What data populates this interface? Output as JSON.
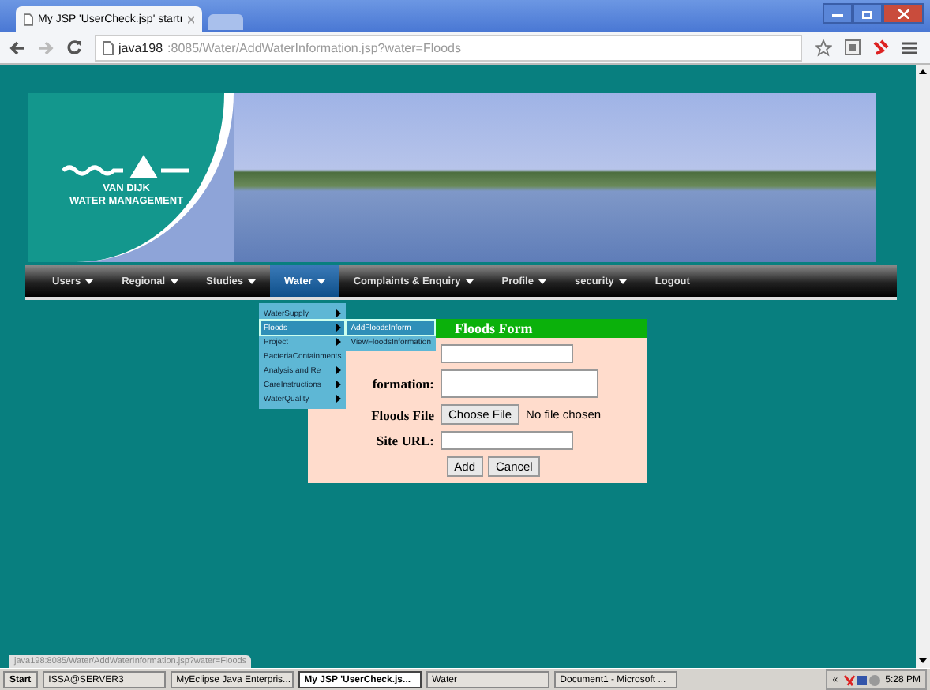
{
  "browser": {
    "tabs": [
      {
        "title": "My JSP 'UserCheck.jsp' startı",
        "selected": true
      }
    ],
    "url_host": "java198",
    "url_path": ":8085/Water/AddWaterInformation.jsp?water=Floods"
  },
  "logo": {
    "line1": "VAN DIJK",
    "line2": "WATER MANAGEMENT"
  },
  "nav": [
    {
      "label": "Users",
      "dropdown": true,
      "selected": false
    },
    {
      "label": "Regional",
      "dropdown": true,
      "selected": false
    },
    {
      "label": "Studies",
      "dropdown": true,
      "selected": false
    },
    {
      "label": "Water",
      "dropdown": true,
      "selected": true
    },
    {
      "label": "Complaints & Enquiry",
      "dropdown": true,
      "selected": false
    },
    {
      "label": "Profile",
      "dropdown": true,
      "selected": false
    },
    {
      "label": "security",
      "dropdown": true,
      "selected": false
    },
    {
      "label": "Logout",
      "dropdown": false,
      "selected": false
    }
  ],
  "menu": {
    "items": [
      {
        "label": "WaterSupply",
        "submenu": true,
        "selected": false
      },
      {
        "label": "Floods",
        "submenu": true,
        "selected": true
      },
      {
        "label": "Project",
        "submenu": true,
        "selected": false
      },
      {
        "label": "BacteriaContainments",
        "submenu": false,
        "selected": false
      },
      {
        "label": "Analysis and Re",
        "submenu": true,
        "selected": false
      },
      {
        "label": "CareInstructions",
        "submenu": true,
        "selected": false
      },
      {
        "label": "WaterQuality",
        "submenu": true,
        "selected": false
      }
    ],
    "submenu": [
      {
        "label": "AddFloodsInform",
        "selected": true
      },
      {
        "label": "ViewFloodsInformation",
        "selected": false
      }
    ]
  },
  "form": {
    "title": "Floods Form",
    "fields": [
      {
        "kind": "text"
      },
      {
        "kind": "textarea",
        "label": "formation:"
      },
      {
        "kind": "file",
        "label": "Floods File",
        "button": "Choose File",
        "status": "No file chosen"
      },
      {
        "kind": "text",
        "label": "Site URL:"
      }
    ],
    "buttons": [
      "Add",
      "Cancel"
    ]
  },
  "status_url": "java198:8085/Water/AddWaterInformation.jsp?water=Floods",
  "taskbar": {
    "start": "Start",
    "items": [
      {
        "label": "ISSA@SERVER3",
        "selected": false
      },
      {
        "label": "MyEclipse Java Enterpris...",
        "selected": false
      },
      {
        "label": "My JSP 'UserCheck.js...",
        "selected": true
      },
      {
        "label": "Water",
        "selected": false
      },
      {
        "label": "Document1 - Microsoft ...",
        "selected": false
      }
    ],
    "tray_arrow": "«",
    "clock": "5:28 PM"
  }
}
